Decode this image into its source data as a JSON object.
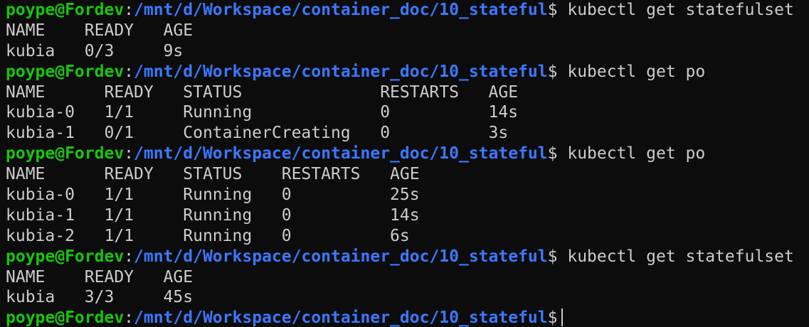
{
  "prompt": {
    "user_host": "poype@Fordev",
    "separator": ":",
    "path": "/mnt/d/Workspace/container_doc/10_stateful",
    "dollar": "$"
  },
  "blocks": [
    {
      "command": "kubectl get statefulset",
      "output": [
        "NAME    READY   AGE",
        "kubia   0/3     9s"
      ]
    },
    {
      "command": "kubectl get po",
      "output": [
        "NAME      READY   STATUS              RESTARTS   AGE",
        "kubia-0   1/1     Running             0          14s",
        "kubia-1   0/1     ContainerCreating   0          3s"
      ]
    },
    {
      "command": "kubectl get po",
      "output": [
        "NAME      READY   STATUS    RESTARTS   AGE",
        "kubia-0   1/1     Running   0          25s",
        "kubia-1   1/1     Running   0          14s",
        "kubia-2   1/1     Running   0          6s"
      ]
    },
    {
      "command": "kubectl get statefulset",
      "output": [
        "NAME    READY   AGE",
        "kubia   3/3     45s"
      ]
    }
  ],
  "colors": {
    "background": "#0c0c0c",
    "text": "#cccccc",
    "user_host": "#16c60c",
    "path": "#3b78ff"
  }
}
